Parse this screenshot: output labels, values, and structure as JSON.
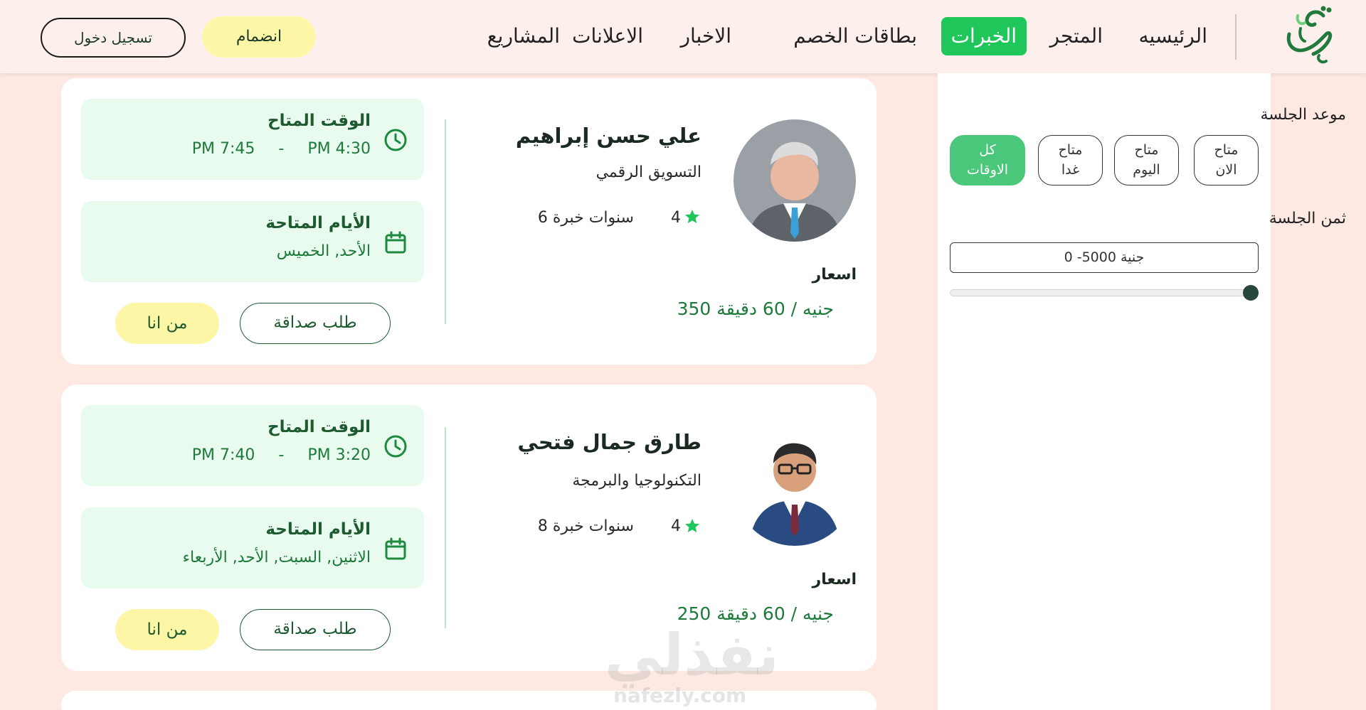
{
  "header": {
    "logo_alt": "صديق",
    "nav": [
      {
        "label": "الرئيسيه"
      },
      {
        "label": "المتجر"
      },
      {
        "label": "الخبرات"
      },
      {
        "label": "بطاقات الخصم"
      },
      {
        "label": "الاخبار"
      },
      {
        "label": "الاعلانات"
      },
      {
        "label": "المشاريع"
      }
    ],
    "join_label": "انضمام",
    "login_label": "تسجيل دخول"
  },
  "sidebar": {
    "session_time_label": "موعد الجلسة",
    "time_filters": [
      {
        "line1": "متاح",
        "line2": "الان"
      },
      {
        "line1": "متاح",
        "line2": "اليوم"
      },
      {
        "line1": "متاح",
        "line2": "غدا"
      },
      {
        "line1": "كل",
        "line2": "الاوقات"
      }
    ],
    "price_label": "ثمن الجلسة",
    "price_range": "جنية 5000- 0",
    "price_slider_value": 1.0
  },
  "experts": [
    {
      "name": "علي حسن إبراهيم",
      "field": "التسويق الرقمي",
      "rating": "4",
      "experience": "6 سنوات خبرة",
      "prices_title": "اسعار",
      "price": "350 جنيه / 60 دقيقة",
      "time_title": "الوقت المتاح",
      "time_from": "PM 4:30",
      "time_sep": "-",
      "time_to": "PM 7:45",
      "days_title": "الأيام المتاحة",
      "days": "الأحد, الخميس",
      "friend_label": "طلب صداقة",
      "about_label": "من انا"
    },
    {
      "name": "طارق جمال فتحي",
      "field": "التكنولوجيا والبرمجة",
      "rating": "4",
      "experience": "8 سنوات خبرة",
      "prices_title": "اسعار",
      "price": "250 جنيه / 60 دقيقة",
      "time_title": "الوقت المتاح",
      "time_from": "PM 3:20",
      "time_sep": "-",
      "time_to": "PM 7:40",
      "days_title": "الأيام المتاحة",
      "days": "الاثنين, السبت, الأحد, الأربعاء",
      "friend_label": "طلب صداقة",
      "about_label": "من انا"
    }
  ],
  "watermark": {
    "main": "نفذلي",
    "sub": "nafezly.com"
  },
  "colors": {
    "page_bg": "#fde8e2",
    "header_bg": "#fdf0ec",
    "accent_green": "#1fc65a",
    "soft_green": "#e9fbef",
    "text_green": "#1d7a3a",
    "yellow": "#fdf6a7"
  }
}
